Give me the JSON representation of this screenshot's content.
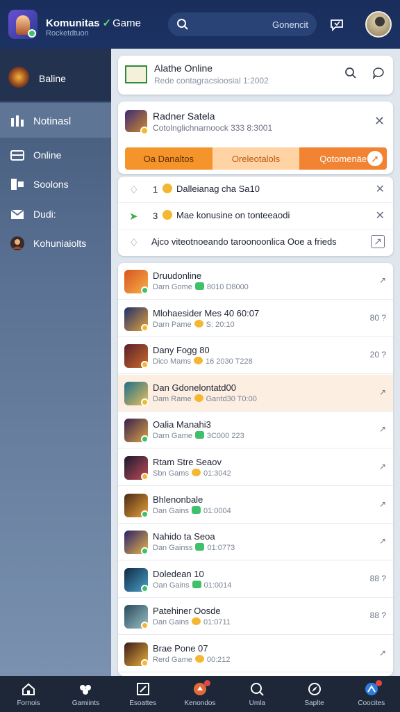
{
  "header": {
    "app_title_a": "Komunitas",
    "app_title_b": "Game",
    "app_subtitle": "Rocketdtuon",
    "search_label": "Gonencit",
    "accent": "#1b3263"
  },
  "sidebar": {
    "profile_label": "Baline",
    "items": [
      {
        "label": "Notinasl",
        "icon": "bar-chart-icon"
      },
      {
        "label": "Online",
        "icon": "inbox-icon"
      },
      {
        "label": "Soolons",
        "icon": "chat-icon"
      },
      {
        "label": "Dudi:",
        "icon": "mail-icon"
      },
      {
        "label": "Kohuniaiolts",
        "icon": "user-avatar-icon"
      }
    ]
  },
  "top_card": {
    "title": "Alathe Online",
    "subtitle": "Rede contagracsioosial 1:2002"
  },
  "feature_card": {
    "title": "Radner Satela",
    "subtitle": "Cotolnglichnarnoock 333 8:3001",
    "tabs": [
      "Oa Danaltos",
      "Oreleotalols",
      "Qotomenäe"
    ],
    "tab_colors": [
      "#f6942c",
      "#ffd3a4",
      "#f28333"
    ]
  },
  "notifications": [
    {
      "num": "1",
      "text": "Dalleianag cha Sa10"
    },
    {
      "num": "3",
      "text": "Mae konusine on tonteeaodi"
    },
    {
      "num": "",
      "text": "Ajco viteotnoeando taroonoonlica Ooe a frieds"
    }
  ],
  "games": [
    {
      "name": "Druudonline",
      "meta_a": "Darn Gome",
      "meta_b": "8010 D8000",
      "action": "↗",
      "color_a": "#d9531e",
      "color_b": "#f5b24a",
      "badge": "green",
      "highlight": false
    },
    {
      "name": "Mlohaesider Mes 40 60:07",
      "meta_a": "Darn Pame",
      "meta_b": "S: 20:10",
      "action": "80 ?",
      "color_a": "#1e2f6b",
      "color_b": "#e3a23a",
      "badge": "emoji",
      "highlight": false
    },
    {
      "name": "Dany Fogg 80",
      "meta_a": "Dico Mams",
      "meta_b": "16 2030 T228",
      "action": "20 ?",
      "color_a": "#5a1f2a",
      "color_b": "#c96b2c",
      "badge": "emoji",
      "highlight": false
    },
    {
      "name": "Dan Gdonelontatd00",
      "meta_a": "Dam Rame",
      "meta_b": "Gantd30 T0:00",
      "action": "↗",
      "color_a": "#1f6d8a",
      "color_b": "#e9c25a",
      "badge": "emoji",
      "highlight": true
    },
    {
      "name": "Oalia Manahi3",
      "meta_a": "Darn Game",
      "meta_b": "3C000 223",
      "action": "↗",
      "color_a": "#3a1f4a",
      "color_b": "#d9a44a",
      "badge": "green",
      "highlight": false
    },
    {
      "name": "Rtam Stre Seaov",
      "meta_a": "Sbn Gams",
      "meta_b": "01:3042",
      "action": "↗",
      "color_a": "#1a1a2e",
      "color_b": "#c04a5a",
      "badge": "emoji",
      "highlight": false
    },
    {
      "name": "Bhlenonbale",
      "meta_a": "Dan Gains",
      "meta_b": "01:0004",
      "action": "↗",
      "color_a": "#4a2a14",
      "color_b": "#e8a13a",
      "badge": "green",
      "highlight": false
    },
    {
      "name": "Nahido ta Seoa",
      "meta_a": "Dan Gainss",
      "meta_b": "01:0773",
      "action": "↗",
      "color_a": "#2a1f6a",
      "color_b": "#e8b84a",
      "badge": "green",
      "highlight": false
    },
    {
      "name": "Doledean 10",
      "meta_a": "Oan Gains",
      "meta_b": "01:0014",
      "action": "88 ?",
      "color_a": "#0f2a44",
      "color_b": "#4aa0c8",
      "badge": "green",
      "highlight": false
    },
    {
      "name": "Patehiner Oosde",
      "meta_a": "Dan Gains",
      "meta_b": "01:0711",
      "action": "88 ?",
      "color_a": "#2a4a5a",
      "color_b": "#9ac0c8",
      "badge": "emoji",
      "highlight": false
    },
    {
      "name": "Brae Pone 07",
      "meta_a": "Rerd Game",
      "meta_b": "00:212",
      "action": "↗",
      "color_a": "#3a1a1a",
      "color_b": "#e8b03a",
      "badge": "emoji",
      "highlight": false
    }
  ],
  "bottom_nav": [
    {
      "label": "Fornois",
      "icon": "home-icon"
    },
    {
      "label": "Gamiints",
      "icon": "community-icon"
    },
    {
      "label": "Esoattes",
      "icon": "edit-icon"
    },
    {
      "label": "Kenondos",
      "icon": "notification-icon",
      "badge": true
    },
    {
      "label": "Umla",
      "icon": "search-icon"
    },
    {
      "label": "Saplte",
      "icon": "compass-icon"
    },
    {
      "label": "Coocites",
      "icon": "profile-icon",
      "badge": true
    }
  ]
}
